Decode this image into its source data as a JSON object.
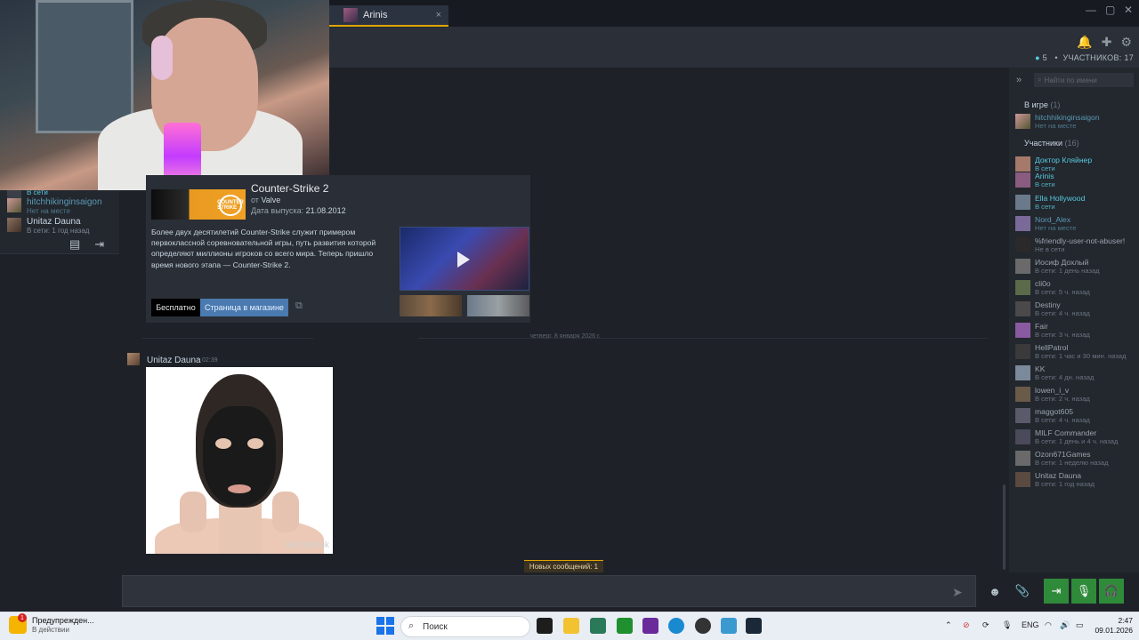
{
  "chat_tab": {
    "name": "Arinis",
    "close": "×"
  },
  "window_controls": {
    "minimize": "—",
    "maximize": "▢",
    "close": "✕"
  },
  "header": {
    "online_count": "5",
    "members_label": "УЧАСТНИКОВ: 17"
  },
  "left_friends": [
    {
      "name": "",
      "status": "В сети"
    },
    {
      "name": "hitchhikinginsaigon",
      "status": "Нет на месте"
    },
    {
      "name": "Unitaz Dauna",
      "status": "В сети: 1 год назад"
    }
  ],
  "game_card": {
    "title": "Counter-Strike 2",
    "from_label": "от",
    "developer": "Valve",
    "release_label": "Дата выпуска:",
    "release_date": "21.08.2012",
    "description": "Более двух десятилетий Counter-Strike служит примером первоклассной соревновательной игры, путь развития которой определяют миллионы игроков со всего мира. Теперь пришло время нового этапа — Counter-Strike 2.",
    "free_label": "Бесплатно",
    "store_label": "Страница в магазине",
    "cover_text": "COUNTER STRIKE"
  },
  "date_divider": "четверг, 8 января 2026 г.",
  "message": {
    "author": "Unitaz Dauna",
    "time": "02:39",
    "watermark": "BelOptovik"
  },
  "new_messages": "Новых сообщений: 1",
  "members_panel": {
    "search_placeholder": "Найти по имени",
    "ingame_title": "В игре",
    "ingame_count": "(1)",
    "members_title": "Участники",
    "members_count": "(16)",
    "ingame": [
      {
        "name": "hitchhikinginsaigon",
        "status": "Нет на месте",
        "state": "away"
      }
    ],
    "list": [
      {
        "name": "Доктор Кляйнер",
        "status": "В сети",
        "state": "on"
      },
      {
        "name": "Arinis",
        "status": "В сети",
        "state": "on"
      },
      {
        "name": "Ella Hollywood",
        "status": "В сети",
        "state": "on"
      },
      {
        "name": "Nord_Alex",
        "status": "Нет на месте",
        "state": "away"
      },
      {
        "name": "%friendly-user-not-abuser!",
        "status": "Не в сети",
        "state": "off"
      },
      {
        "name": "Иосиф Дохлый",
        "status": "В сети: 1 день назад",
        "state": "off"
      },
      {
        "name": "cli0o",
        "status": "В сети: 5 ч. назад",
        "state": "off"
      },
      {
        "name": "Destiny",
        "status": "В сети: 4 ч. назад",
        "state": "off"
      },
      {
        "name": "Fair",
        "status": "В сети: 3 ч. назад",
        "state": "off"
      },
      {
        "name": "HellPatrol",
        "status": "В сети: 1 час и 30 мин. назад",
        "state": "off"
      },
      {
        "name": "KK",
        "status": "В сети: 4 дн. назад",
        "state": "off"
      },
      {
        "name": "lowen_i_v",
        "status": "В сети: 2 ч. назад",
        "state": "off"
      },
      {
        "name": "maggot605",
        "status": "В сети: 4 ч. назад",
        "state": "off"
      },
      {
        "name": "MILF Commander",
        "status": "В сети: 1 день и 4 ч. назад",
        "state": "off"
      },
      {
        "name": "Ozon671Games",
        "status": "В сети: 1 неделю назад",
        "state": "off"
      },
      {
        "name": "Unitaz Dauna",
        "status": "В сети: 1 год назад",
        "state": "off"
      }
    ]
  },
  "taskbar": {
    "warning_title": "Предупрежден...",
    "warning_sub": "В действии",
    "warning_badge": "1",
    "search_label": "Поиск",
    "lang": "ENG",
    "time": "2:47",
    "date": "09.01.2026"
  },
  "colors": {
    "accent_online": "#57cbde",
    "accent_ingame": "#8fbf4a",
    "voice_green": "#2f8a3a",
    "new_msg_border": "#e0a400"
  }
}
